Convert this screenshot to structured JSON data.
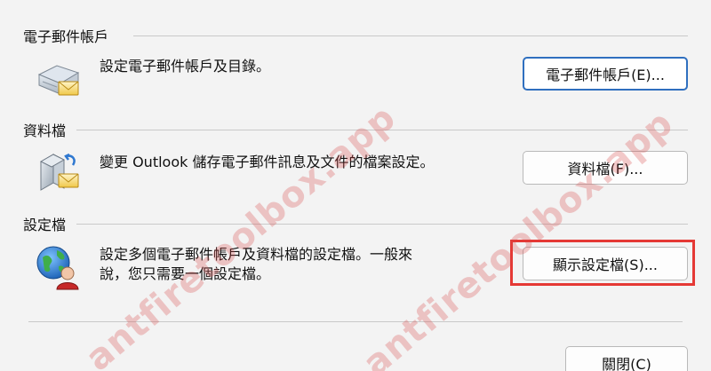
{
  "sections": {
    "email": {
      "title": "電子郵件帳戶",
      "description": "設定電子郵件帳戶及目錄。",
      "button": "電子郵件帳戶(E)...",
      "icon": "email-accounts-icon"
    },
    "datafiles": {
      "title": "資料檔",
      "description": "變更 Outlook 儲存電子郵件訊息及文件的檔案設定。",
      "button": "資料檔(F)...",
      "icon": "data-files-icon"
    },
    "profiles": {
      "title": "設定檔",
      "description_line1": "設定多個電子郵件帳戶及資料檔的設定檔。一般來",
      "description_line2": "說，您只需要一個設定檔。",
      "button": "顯示設定檔(S)...",
      "icon": "profiles-globe-icon"
    }
  },
  "close_button": "關閉(C)",
  "watermark": {
    "text": "antfiretoolbox.app",
    "color": "#d64646"
  },
  "highlight_color": "#e53935"
}
